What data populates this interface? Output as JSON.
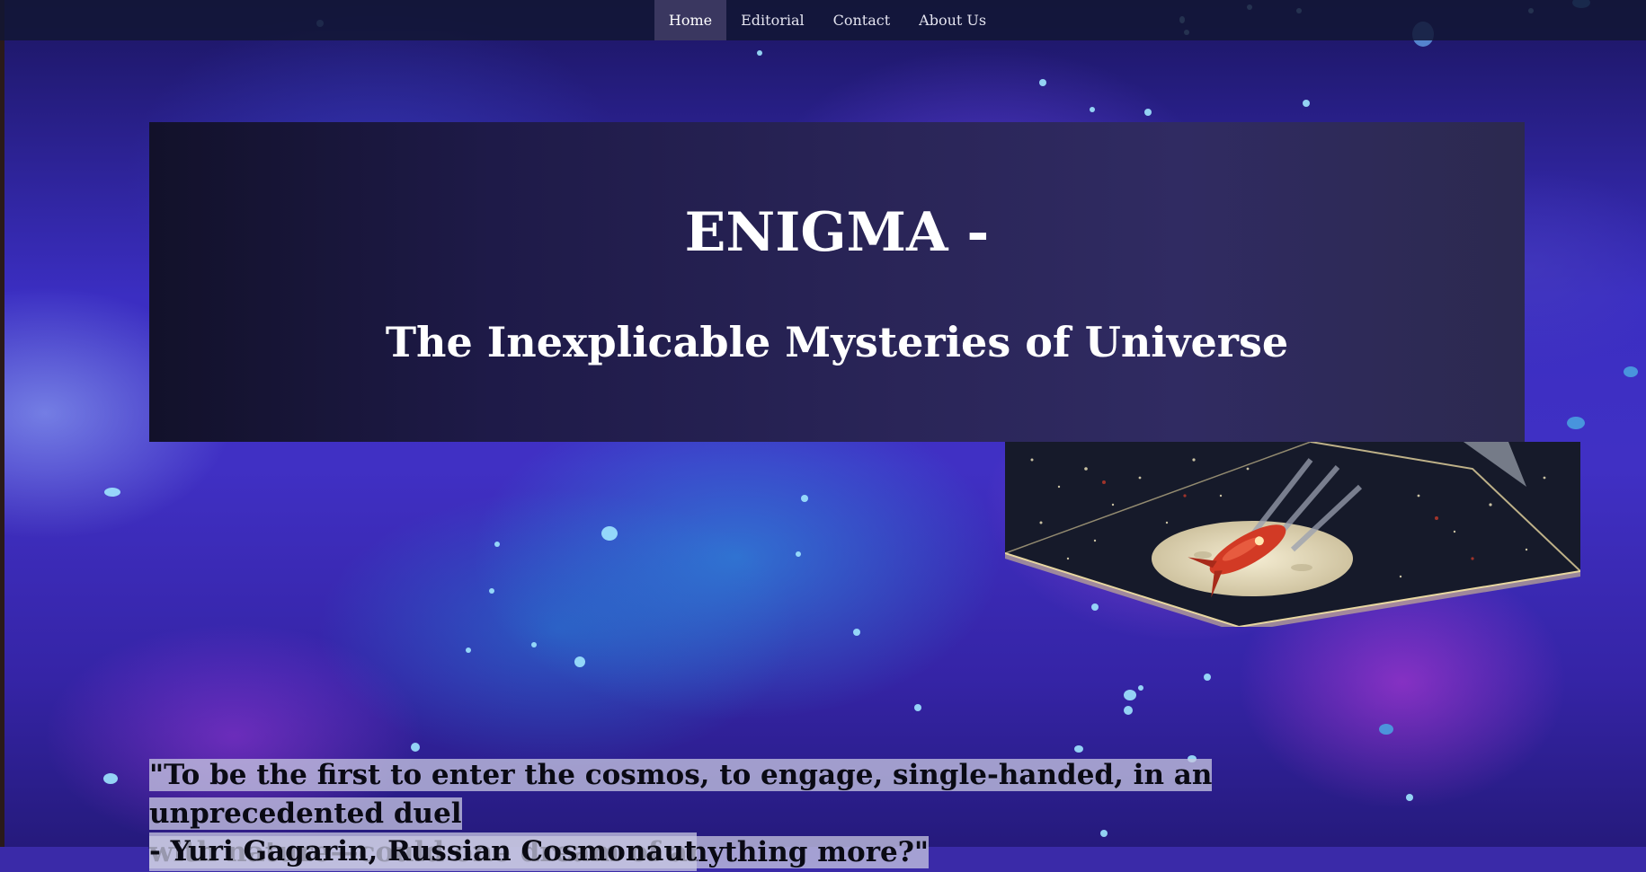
{
  "nav": {
    "items": [
      {
        "label": "Home",
        "active": true
      },
      {
        "label": "Editorial",
        "active": false
      },
      {
        "label": "Contact",
        "active": false
      },
      {
        "label": "About Us",
        "active": false
      }
    ]
  },
  "hero": {
    "title": "ENIGMA -",
    "subtitle": "The Inexplicable Mysteries of Universe"
  },
  "quote": {
    "line1": "\"To be the first to enter the cosmos, to engage, single-handed, in an unprecedented duel",
    "line2": "with nature—could one dream of anything more?\"",
    "author": "- Yuri Gagarin, Russian Cosmonaut"
  },
  "colors": {
    "nav_bg": "#12162f",
    "nav_active": "#3a3760",
    "hero_bg_start": "#12112a",
    "hero_bg_end": "#2c294f",
    "quote_highlight": "#c8c8e1"
  },
  "icons": {
    "cube": "rocket-cube-graphic"
  }
}
